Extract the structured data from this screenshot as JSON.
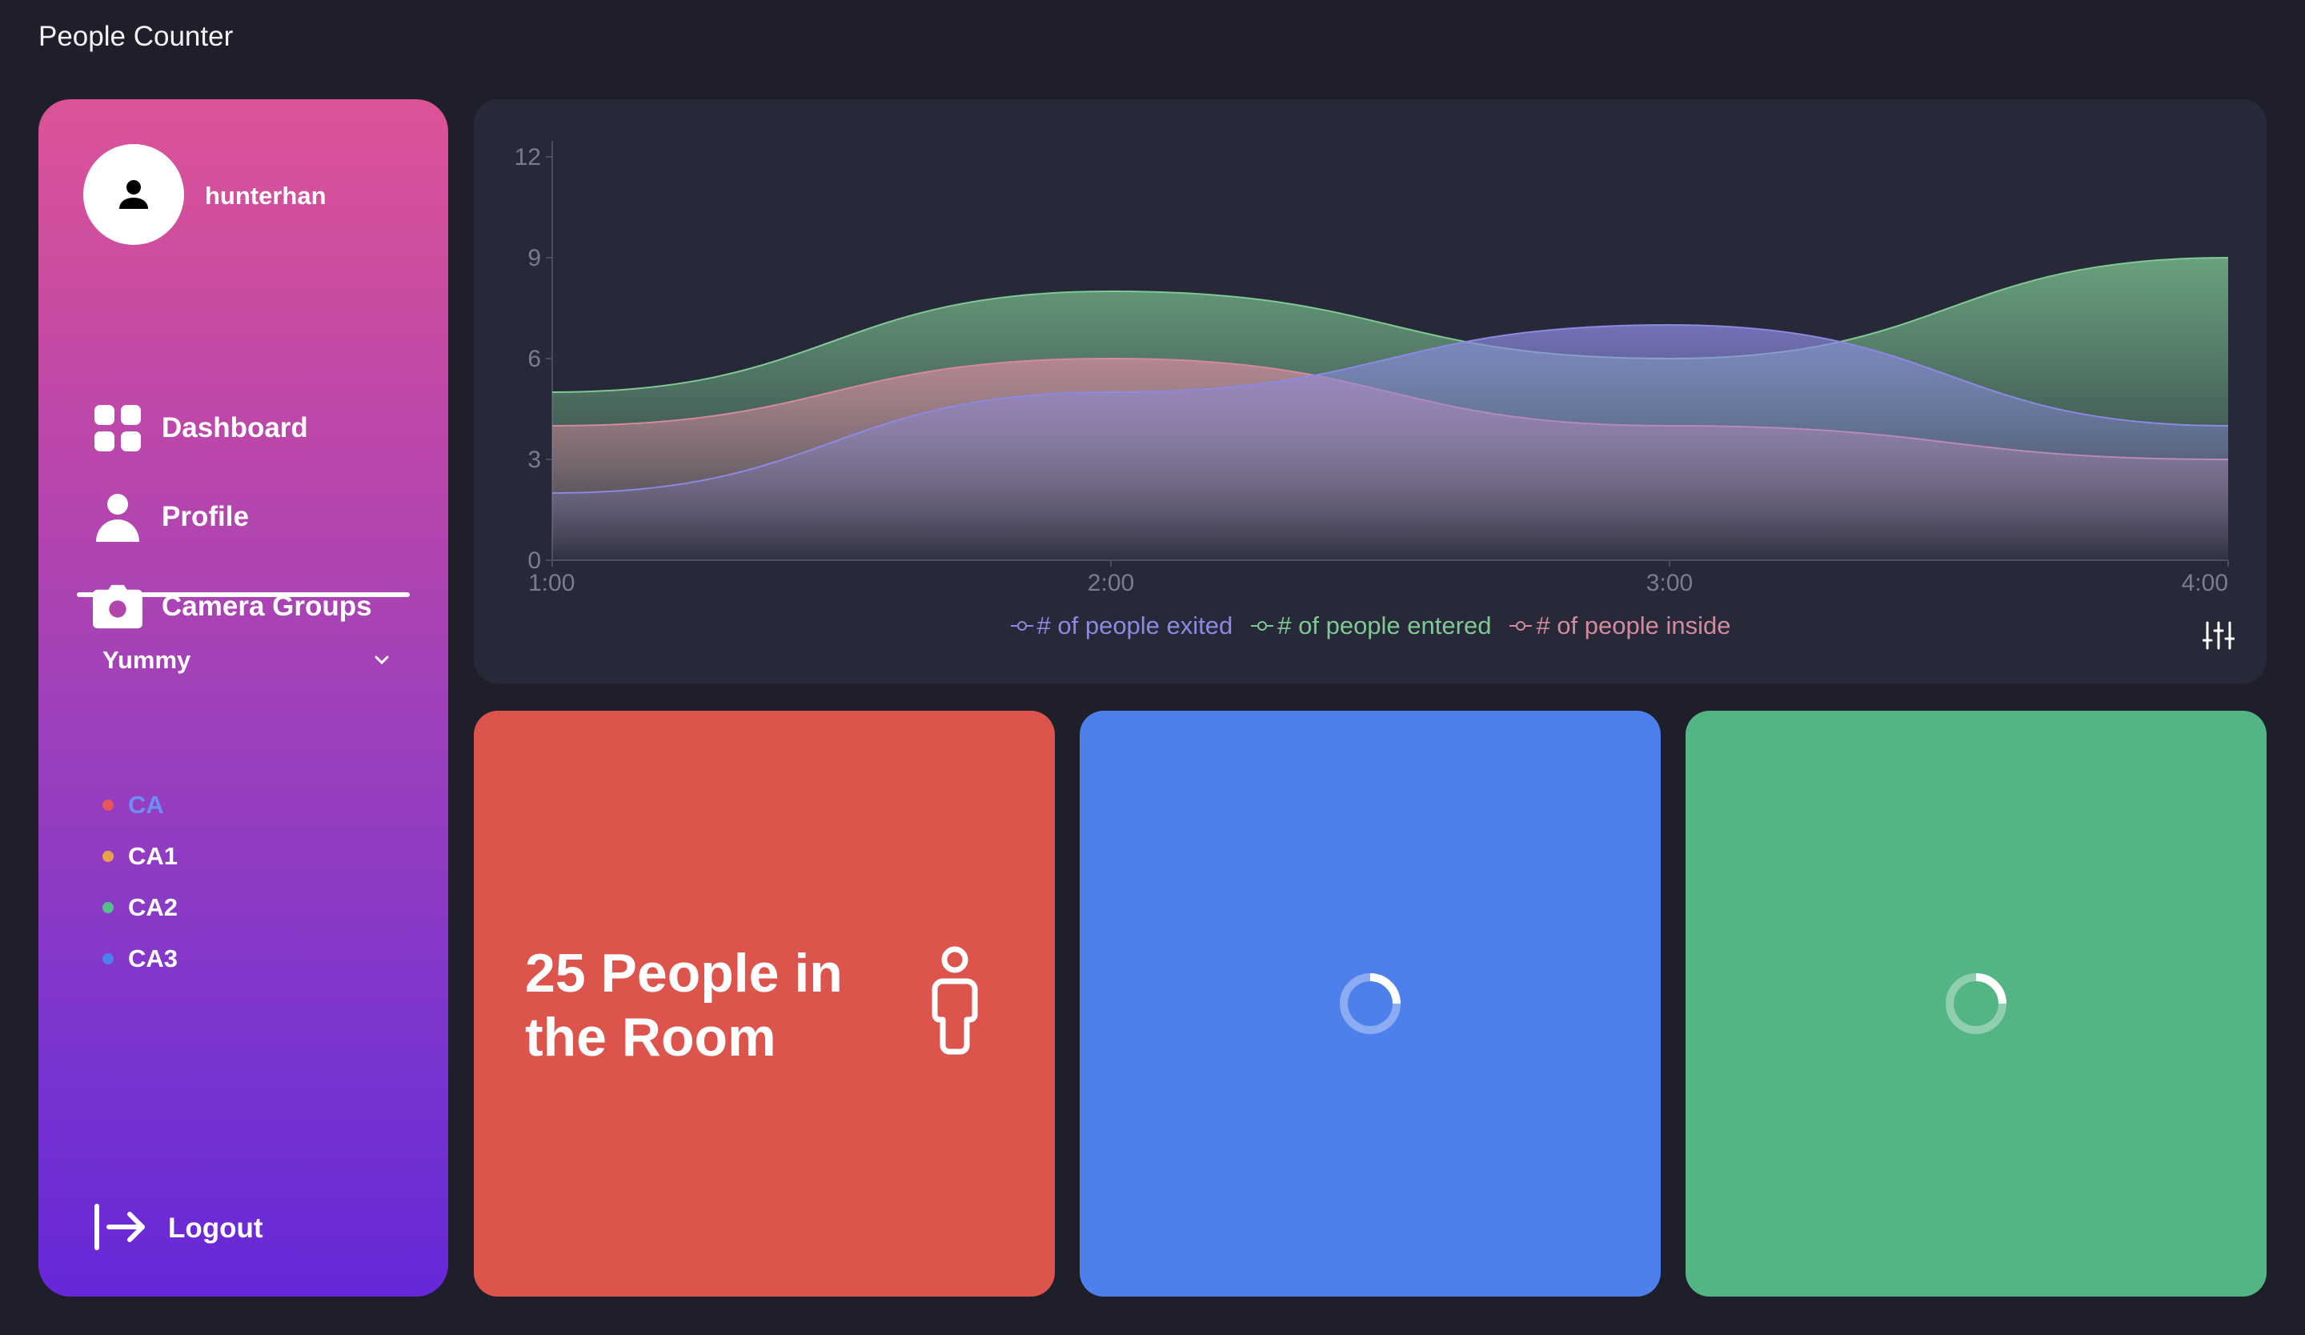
{
  "app": {
    "title": "People Counter"
  },
  "sidebar": {
    "username": "hunterhan",
    "nav": [
      {
        "label": "Dashboard",
        "icon": "grid-icon"
      },
      {
        "label": "Profile",
        "icon": "user-icon"
      },
      {
        "label": "Camera Groups",
        "icon": "camera-icon"
      }
    ],
    "group": {
      "label": "Yummy"
    },
    "cameras": [
      {
        "label": "CA",
        "dot_color": "#e8555b",
        "text_color": "#6d8ef5"
      },
      {
        "label": "CA1",
        "dot_color": "#e9a24b",
        "text_color": "#ffffff"
      },
      {
        "label": "CA2",
        "dot_color": "#55c08a",
        "text_color": "#ffffff"
      },
      {
        "label": "CA3",
        "dot_color": "#4e7ff0",
        "text_color": "#ffffff"
      }
    ],
    "logout_label": "Logout"
  },
  "chart_data": {
    "type": "area",
    "x": [
      "1:00",
      "2:00",
      "3:00",
      "4:00"
    ],
    "ylim": [
      0,
      12
    ],
    "yticks": [
      0,
      3,
      6,
      9,
      12
    ],
    "series": [
      {
        "name": "# of people exited",
        "color": "#8b89e0",
        "values": [
          2,
          5,
          7,
          4
        ]
      },
      {
        "name": "# of people entered",
        "color": "#7fc994",
        "values": [
          5,
          8,
          6,
          9
        ]
      },
      {
        "name": "# of people inside",
        "color": "#d48a9e",
        "values": [
          4,
          6,
          4,
          3
        ]
      }
    ]
  },
  "cards": {
    "people_text": "25 People in the Room",
    "colors": {
      "red": "#dd544d",
      "blue": "#4e80ec",
      "green": "#53b584"
    }
  }
}
